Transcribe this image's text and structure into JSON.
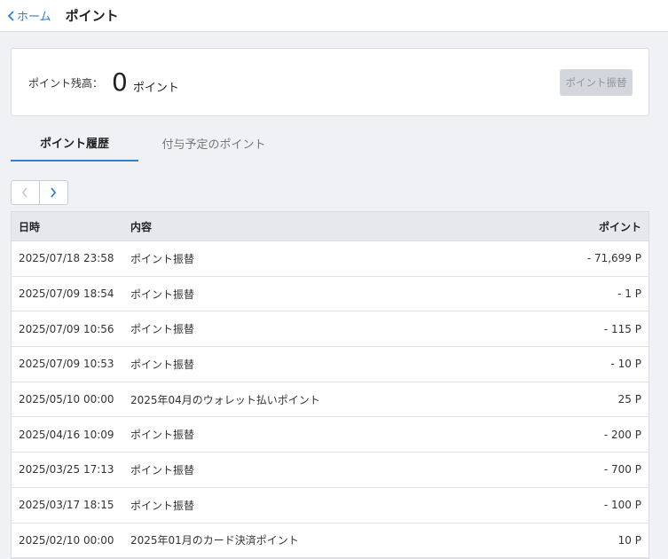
{
  "header": {
    "back_label": "ホーム",
    "title": "ポイント"
  },
  "balance": {
    "label": "ポイント残高：",
    "value": "0",
    "unit": "ポイント",
    "transfer_button": "ポイント振替"
  },
  "tabs": [
    {
      "label": "ポイント履歴",
      "active": true
    },
    {
      "label": "付与予定のポイント",
      "active": false
    }
  ],
  "table": {
    "headers": {
      "date": "日時",
      "content": "内容",
      "points": "ポイント"
    },
    "rows": [
      {
        "date": "2025/07/18 23:58",
        "content": "ポイント振替",
        "points": "- 71,699 P"
      },
      {
        "date": "2025/07/09 18:54",
        "content": "ポイント振替",
        "points": "- 1 P"
      },
      {
        "date": "2025/07/09 10:56",
        "content": "ポイント振替",
        "points": "- 115 P"
      },
      {
        "date": "2025/07/09 10:53",
        "content": "ポイント振替",
        "points": "- 10 P"
      },
      {
        "date": "2025/05/10 00:00",
        "content": "2025年04月のウォレット払いポイント",
        "points": "25 P"
      },
      {
        "date": "2025/04/16 10:09",
        "content": "ポイント振替",
        "points": "- 200 P"
      },
      {
        "date": "2025/03/25 17:13",
        "content": "ポイント振替",
        "points": "- 700 P"
      },
      {
        "date": "2025/03/17 18:15",
        "content": "ポイント振替",
        "points": "- 100 P"
      },
      {
        "date": "2025/02/10 00:00",
        "content": "2025年01月のカード決済ポイント",
        "points": "10 P"
      }
    ]
  },
  "colors": {
    "accent": "#2f7fd6",
    "disabled_button": "#d3d6dc"
  },
  "icons": {
    "back": "chevron-left-icon",
    "prev": "chevron-left-icon",
    "next": "chevron-right-icon"
  }
}
